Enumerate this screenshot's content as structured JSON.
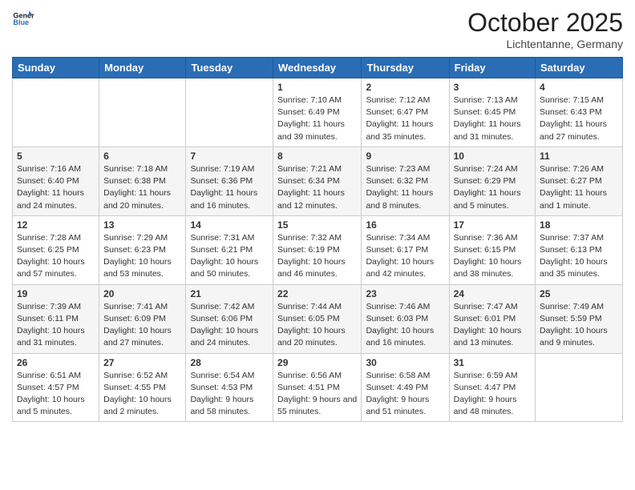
{
  "logo": {
    "line1": "General",
    "line2": "Blue"
  },
  "header": {
    "month": "October 2025",
    "location": "Lichtentanne, Germany"
  },
  "weekdays": [
    "Sunday",
    "Monday",
    "Tuesday",
    "Wednesday",
    "Thursday",
    "Friday",
    "Saturday"
  ],
  "weeks": [
    [
      {
        "day": "",
        "info": ""
      },
      {
        "day": "",
        "info": ""
      },
      {
        "day": "",
        "info": ""
      },
      {
        "day": "1",
        "info": "Sunrise: 7:10 AM\nSunset: 6:49 PM\nDaylight: 11 hours and 39 minutes."
      },
      {
        "day": "2",
        "info": "Sunrise: 7:12 AM\nSunset: 6:47 PM\nDaylight: 11 hours and 35 minutes."
      },
      {
        "day": "3",
        "info": "Sunrise: 7:13 AM\nSunset: 6:45 PM\nDaylight: 11 hours and 31 minutes."
      },
      {
        "day": "4",
        "info": "Sunrise: 7:15 AM\nSunset: 6:43 PM\nDaylight: 11 hours and 27 minutes."
      }
    ],
    [
      {
        "day": "5",
        "info": "Sunrise: 7:16 AM\nSunset: 6:40 PM\nDaylight: 11 hours and 24 minutes."
      },
      {
        "day": "6",
        "info": "Sunrise: 7:18 AM\nSunset: 6:38 PM\nDaylight: 11 hours and 20 minutes."
      },
      {
        "day": "7",
        "info": "Sunrise: 7:19 AM\nSunset: 6:36 PM\nDaylight: 11 hours and 16 minutes."
      },
      {
        "day": "8",
        "info": "Sunrise: 7:21 AM\nSunset: 6:34 PM\nDaylight: 11 hours and 12 minutes."
      },
      {
        "day": "9",
        "info": "Sunrise: 7:23 AM\nSunset: 6:32 PM\nDaylight: 11 hours and 8 minutes."
      },
      {
        "day": "10",
        "info": "Sunrise: 7:24 AM\nSunset: 6:29 PM\nDaylight: 11 hours and 5 minutes."
      },
      {
        "day": "11",
        "info": "Sunrise: 7:26 AM\nSunset: 6:27 PM\nDaylight: 11 hours and 1 minute."
      }
    ],
    [
      {
        "day": "12",
        "info": "Sunrise: 7:28 AM\nSunset: 6:25 PM\nDaylight: 10 hours and 57 minutes."
      },
      {
        "day": "13",
        "info": "Sunrise: 7:29 AM\nSunset: 6:23 PM\nDaylight: 10 hours and 53 minutes."
      },
      {
        "day": "14",
        "info": "Sunrise: 7:31 AM\nSunset: 6:21 PM\nDaylight: 10 hours and 50 minutes."
      },
      {
        "day": "15",
        "info": "Sunrise: 7:32 AM\nSunset: 6:19 PM\nDaylight: 10 hours and 46 minutes."
      },
      {
        "day": "16",
        "info": "Sunrise: 7:34 AM\nSunset: 6:17 PM\nDaylight: 10 hours and 42 minutes."
      },
      {
        "day": "17",
        "info": "Sunrise: 7:36 AM\nSunset: 6:15 PM\nDaylight: 10 hours and 38 minutes."
      },
      {
        "day": "18",
        "info": "Sunrise: 7:37 AM\nSunset: 6:13 PM\nDaylight: 10 hours and 35 minutes."
      }
    ],
    [
      {
        "day": "19",
        "info": "Sunrise: 7:39 AM\nSunset: 6:11 PM\nDaylight: 10 hours and 31 minutes."
      },
      {
        "day": "20",
        "info": "Sunrise: 7:41 AM\nSunset: 6:09 PM\nDaylight: 10 hours and 27 minutes."
      },
      {
        "day": "21",
        "info": "Sunrise: 7:42 AM\nSunset: 6:06 PM\nDaylight: 10 hours and 24 minutes."
      },
      {
        "day": "22",
        "info": "Sunrise: 7:44 AM\nSunset: 6:05 PM\nDaylight: 10 hours and 20 minutes."
      },
      {
        "day": "23",
        "info": "Sunrise: 7:46 AM\nSunset: 6:03 PM\nDaylight: 10 hours and 16 minutes."
      },
      {
        "day": "24",
        "info": "Sunrise: 7:47 AM\nSunset: 6:01 PM\nDaylight: 10 hours and 13 minutes."
      },
      {
        "day": "25",
        "info": "Sunrise: 7:49 AM\nSunset: 5:59 PM\nDaylight: 10 hours and 9 minutes."
      }
    ],
    [
      {
        "day": "26",
        "info": "Sunrise: 6:51 AM\nSunset: 4:57 PM\nDaylight: 10 hours and 5 minutes."
      },
      {
        "day": "27",
        "info": "Sunrise: 6:52 AM\nSunset: 4:55 PM\nDaylight: 10 hours and 2 minutes."
      },
      {
        "day": "28",
        "info": "Sunrise: 6:54 AM\nSunset: 4:53 PM\nDaylight: 9 hours and 58 minutes."
      },
      {
        "day": "29",
        "info": "Sunrise: 6:56 AM\nSunset: 4:51 PM\nDaylight: 9 hours and 55 minutes."
      },
      {
        "day": "30",
        "info": "Sunrise: 6:58 AM\nSunset: 4:49 PM\nDaylight: 9 hours and 51 minutes."
      },
      {
        "day": "31",
        "info": "Sunrise: 6:59 AM\nSunset: 4:47 PM\nDaylight: 9 hours and 48 minutes."
      },
      {
        "day": "",
        "info": ""
      }
    ]
  ]
}
